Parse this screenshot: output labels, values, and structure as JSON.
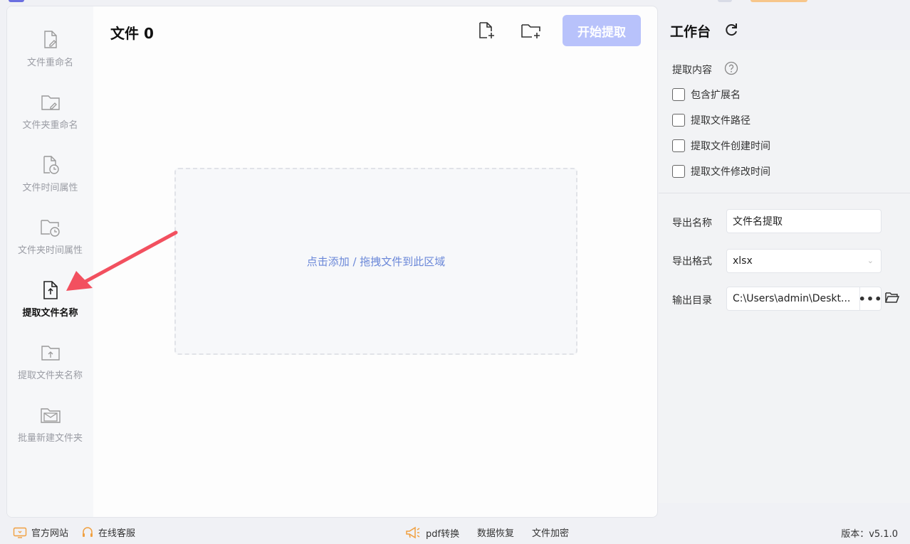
{
  "sidebar": {
    "items": [
      {
        "label": "文件重命名",
        "icon": "file-edit-icon"
      },
      {
        "label": "文件夹重命名",
        "icon": "folder-edit-icon"
      },
      {
        "label": "文件时间属性",
        "icon": "file-clock-icon"
      },
      {
        "label": "文件夹时间属性",
        "icon": "folder-clock-icon"
      },
      {
        "label": "提取文件名称",
        "icon": "file-upload-icon",
        "active": true
      },
      {
        "label": "提取文件夹名称",
        "icon": "folder-upload-icon"
      },
      {
        "label": "批量新建文件夹",
        "icon": "mail-folder-icon"
      }
    ]
  },
  "header": {
    "file_label": "文件",
    "file_count": "0",
    "start_button": "开始提取"
  },
  "dropzone": {
    "hint": "点击添加 / 拖拽文件到此区域"
  },
  "workbench": {
    "title": "工作台",
    "section_label": "提取内容",
    "options": [
      {
        "label": "包含扩展名",
        "checked": false
      },
      {
        "label": "提取文件路径",
        "checked": false
      },
      {
        "label": "提取文件创建时间",
        "checked": false
      },
      {
        "label": "提取文件修改时间",
        "checked": false
      }
    ],
    "export_name_label": "导出名称",
    "export_name_value": "文件名提取",
    "export_format_label": "导出格式",
    "export_format_value": "xlsx",
    "output_dir_label": "输出目录",
    "output_dir_value": "C:\\Users\\admin\\Deskt...",
    "dots": "•••"
  },
  "footer": {
    "official_site": "官方网站",
    "online_service": "在线客服",
    "pdf_convert": "pdf转换",
    "data_recovery": "数据恢复",
    "file_encrypt": "文件加密",
    "version": "版本：v5.1.0"
  },
  "colors": {
    "accent": "#b8c2fb",
    "link": "#6a87d8",
    "arrow": "#f2505f",
    "footer_icon": "#f0a040"
  }
}
